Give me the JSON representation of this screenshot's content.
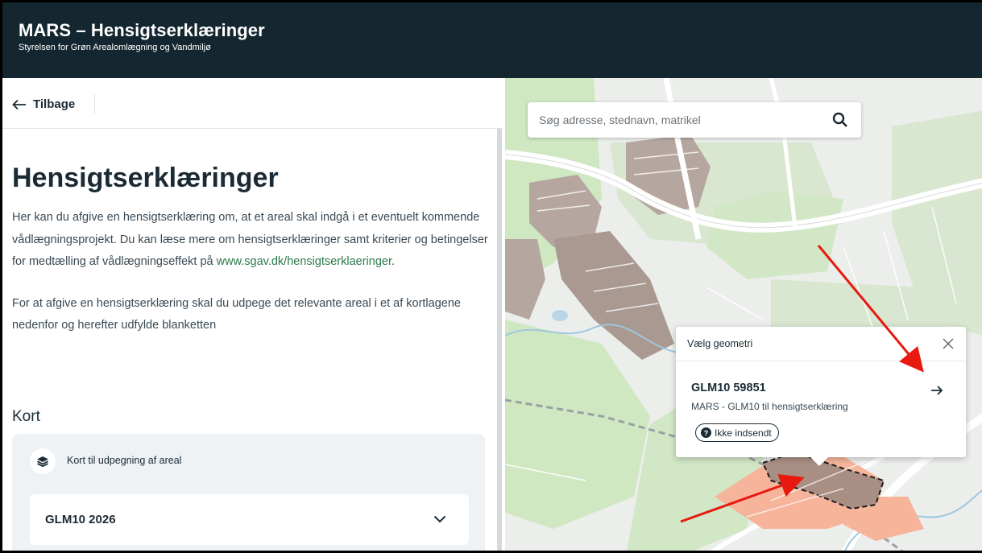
{
  "header": {
    "title": "MARS – Hensigtserklæringer",
    "subtitle": "Styrelsen for Grøn Arealomlægning og Vandmiljø"
  },
  "nav": {
    "back_label": "Tilbage"
  },
  "main": {
    "title": "Hensigtserklæringer",
    "intro_text": "Her kan du afgive en hensigtserklæring om, at et areal skal indgå i et eventuelt kommende vådlægningsprojekt. Du kan læse mere om hensigtserklæringer samt kriterier og betingelser for medtælling af vådlægningseffekt på ",
    "intro_link": "www.sgav.dk/hensigtserklaeringer",
    "intro_end": ".",
    "instruction": "For at afgive en hensigtserklæring skal du udpege det relevante areal i et af kortlagene nedenfor og herefter udfylde blanketten",
    "section_title": "Kort",
    "card_label": "Kort til udpegning af areal",
    "selected_layer": "GLM10 2026"
  },
  "map": {
    "search_placeholder": "Søg adresse, stednavn, matrikel",
    "popup": {
      "title": "Vælg geometri",
      "item_title": "GLM10 59851",
      "item_subtitle": "MARS - GLM10 til hensigtserklæring",
      "status": "Ikke indsendt"
    }
  },
  "colors": {
    "header_bg": "#14262f",
    "link": "#2b7a4b",
    "annotation_arrow": "#e8190f",
    "selected_parcel": "#a98e84",
    "parcel": "#f6b59a"
  },
  "icons": [
    "arrow-left-icon",
    "layers-icon",
    "chevron-down-icon",
    "search-icon",
    "close-icon",
    "arrow-right-icon",
    "question-icon"
  ]
}
